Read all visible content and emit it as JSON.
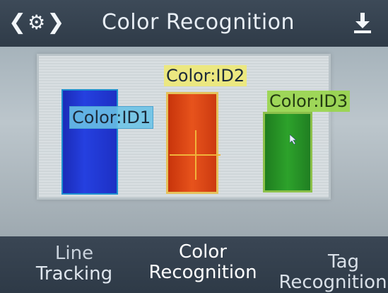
{
  "header": {
    "title": "Color Recognition",
    "left_icons": [
      "chevron-left-icon",
      "gear-icon",
      "chevron-right-icon"
    ],
    "right_icon": "download-icon"
  },
  "preview": {
    "detections": [
      {
        "label": "Color:ID1",
        "color": "#2540e0",
        "label_bg": "#6ac3e6"
      },
      {
        "label": "Color:ID2",
        "color": "#e7531c",
        "label_bg": "#eee878"
      },
      {
        "label": "Color:ID3",
        "color": "#2da22b",
        "label_bg": "#96d646"
      }
    ],
    "crosshair_color": "#f0b33a"
  },
  "tabs": [
    {
      "line1": "Line",
      "line2": "Tracking"
    },
    {
      "line1": "Color",
      "line2": "Recognition",
      "selected": true
    },
    {
      "line1": "Tag",
      "line2": "Recognition"
    }
  ],
  "colors": {
    "header_bg": "#3d4a58",
    "tab_bg": "#3a4654",
    "text": "#e8eef5"
  }
}
